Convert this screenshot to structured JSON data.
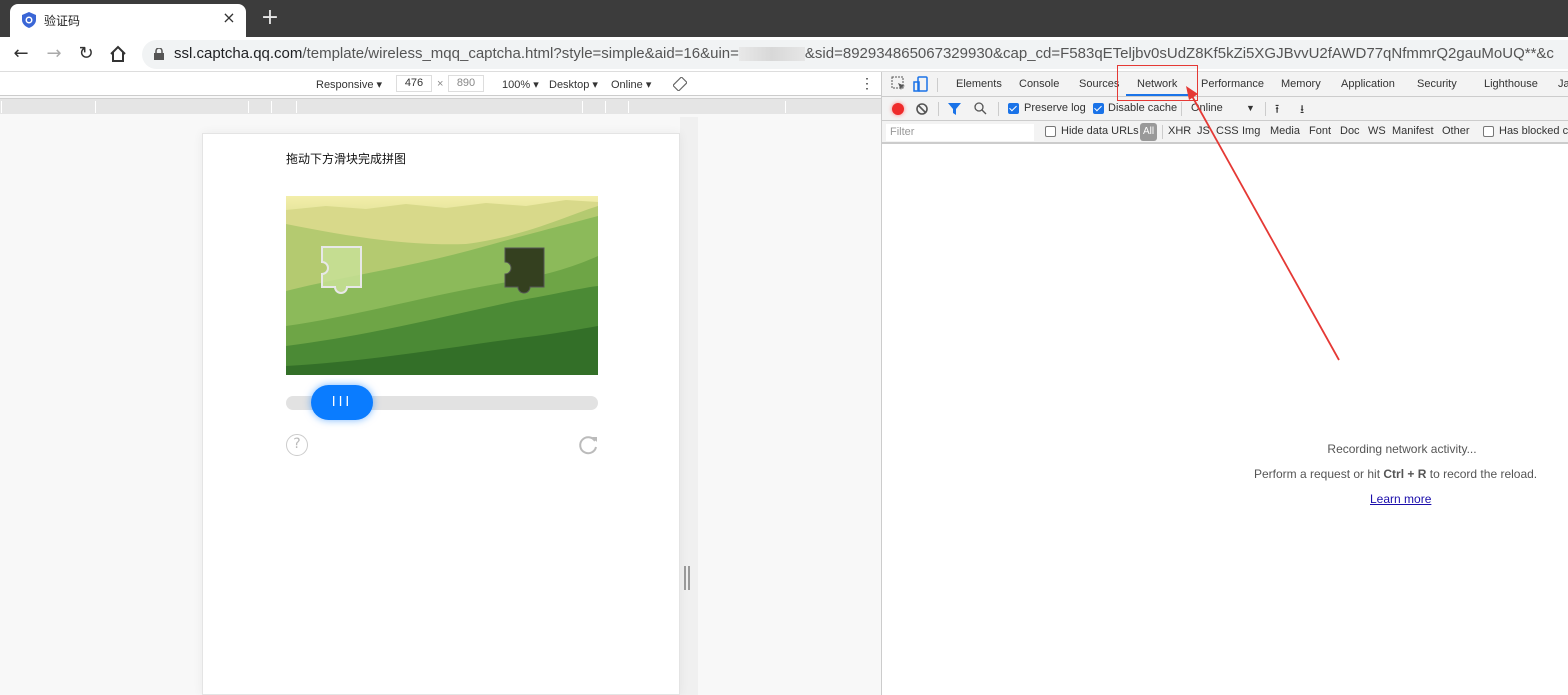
{
  "browser": {
    "tab_title": "验证码",
    "tab_close": "×",
    "new_tab": "+",
    "url_host": "ssl.captcha.qq.com",
    "url_path_a": "/template/wireless_mqq_captcha.html?style=simple&aid=16&uin=",
    "url_path_b": "&sid=892934865067329930&cap_cd=F583qETeljbv0sUdZ8Kf5kZi5XGJBvvU2fAWD77qNfmmrQ2gauMoUQ**&c"
  },
  "device_toolbar": {
    "device": "Responsive ▾",
    "width": "476",
    "times": "×",
    "height": "890",
    "zoom": "100% ▾",
    "ua": "Desktop ▾",
    "network": "Online ▾",
    "more": "⋮"
  },
  "captcha": {
    "instruction": "拖动下方滑块完成拼图",
    "slider_grip": "III",
    "help": "?",
    "slider_progress": 0.09
  },
  "devtools": {
    "tabs": [
      "Elements",
      "Console",
      "Sources",
      "Network",
      "Performance",
      "Memory",
      "Application",
      "Security",
      "Lighthouse",
      "Ja"
    ],
    "active_tab": "Network",
    "preserve_log": "Preserve log",
    "disable_cache": "Disable cache",
    "throttle": "Online",
    "filter_placeholder": "Filter",
    "hide_data_urls": "Hide data URLs",
    "types": [
      "All",
      "XHR",
      "JS",
      "CSS",
      "Img",
      "Media",
      "Font",
      "Doc",
      "WS",
      "Manifest",
      "Other"
    ],
    "has_blocked": "Has blocked co",
    "empty_title": "Recording network activity...",
    "empty_hint_a": "Perform a request or hit ",
    "empty_hint_key": "Ctrl + R",
    "empty_hint_b": " to record the reload.",
    "learn_more": "Learn more"
  },
  "colors": {
    "accent": "#1a73e8",
    "record": "#ef2b2b",
    "slider": "#0a7cff",
    "annotation": "#e53935"
  }
}
